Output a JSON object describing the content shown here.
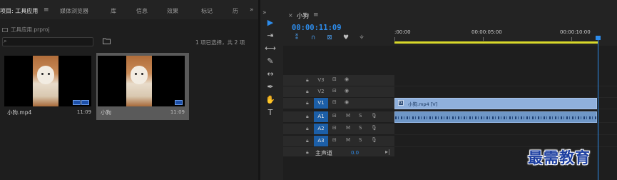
{
  "project_panel": {
    "tabs": [
      {
        "label": "项目: 工具应用"
      },
      {
        "label": "媒体浏览器"
      },
      {
        "label": "库"
      },
      {
        "label": "信息"
      },
      {
        "label": "效果"
      },
      {
        "label": "标记"
      },
      {
        "label": "历"
      }
    ],
    "tab_menu_glyph": "≡",
    "overflow_glyph": "»",
    "project_file": "工具应用.prproj",
    "search_placeholder": "",
    "selection_status": "1 项已选择，共 2 项",
    "items": [
      {
        "name": "小狗.mp4",
        "duration": "11:09",
        "selected": false
      },
      {
        "name": "小狗",
        "duration": "11:09",
        "selected": true
      }
    ]
  },
  "tools": [
    {
      "icon": "selection-tool-icon",
      "glyph": "▶",
      "active": true
    },
    {
      "icon": "track-select-tool-icon",
      "glyph": "⇥",
      "active": false
    },
    {
      "icon": "ripple-edit-tool-icon",
      "glyph": "⟷",
      "active": false
    },
    {
      "icon": "razor-tool-icon",
      "glyph": "✎",
      "active": false
    },
    {
      "icon": "slip-tool-icon",
      "glyph": "↔",
      "active": false
    },
    {
      "icon": "pen-tool-icon",
      "glyph": "✒",
      "active": false
    },
    {
      "icon": "hand-tool-icon",
      "glyph": "✋",
      "active": false
    },
    {
      "icon": "type-tool-icon",
      "glyph": "T",
      "active": false
    }
  ],
  "timeline": {
    "close_glyph": "×",
    "sequence_name": "小狗",
    "menu_glyph": "≡",
    "timecode": "00:00:11:09",
    "ruler_labels": [
      ":00:00",
      "00:00:05:00",
      "00:00:10:00"
    ],
    "tracks": [
      {
        "id": "V3",
        "type": "video",
        "targeted": false
      },
      {
        "id": "V2",
        "type": "video",
        "targeted": false
      },
      {
        "id": "V1",
        "type": "video",
        "targeted": true
      },
      {
        "id": "A1",
        "type": "audio",
        "targeted": true
      },
      {
        "id": "A2",
        "type": "audio",
        "targeted": true
      },
      {
        "id": "A3",
        "type": "audio",
        "targeted": true
      }
    ],
    "audio_buttons": {
      "mute": "M",
      "solo": "S"
    },
    "video_clip_label": "小狗.mp4 [V]",
    "video_clip_fx": "fx",
    "master_label": "主声道",
    "master_value": "0.0"
  },
  "watermark": "最需教育",
  "colors": {
    "accent": "#2d8ceb",
    "video_clip": "#8fb0dc",
    "audio_clip": "#6f97c7",
    "work_area_bar": "#d8d82a",
    "watermark": "#1d3fa0"
  }
}
